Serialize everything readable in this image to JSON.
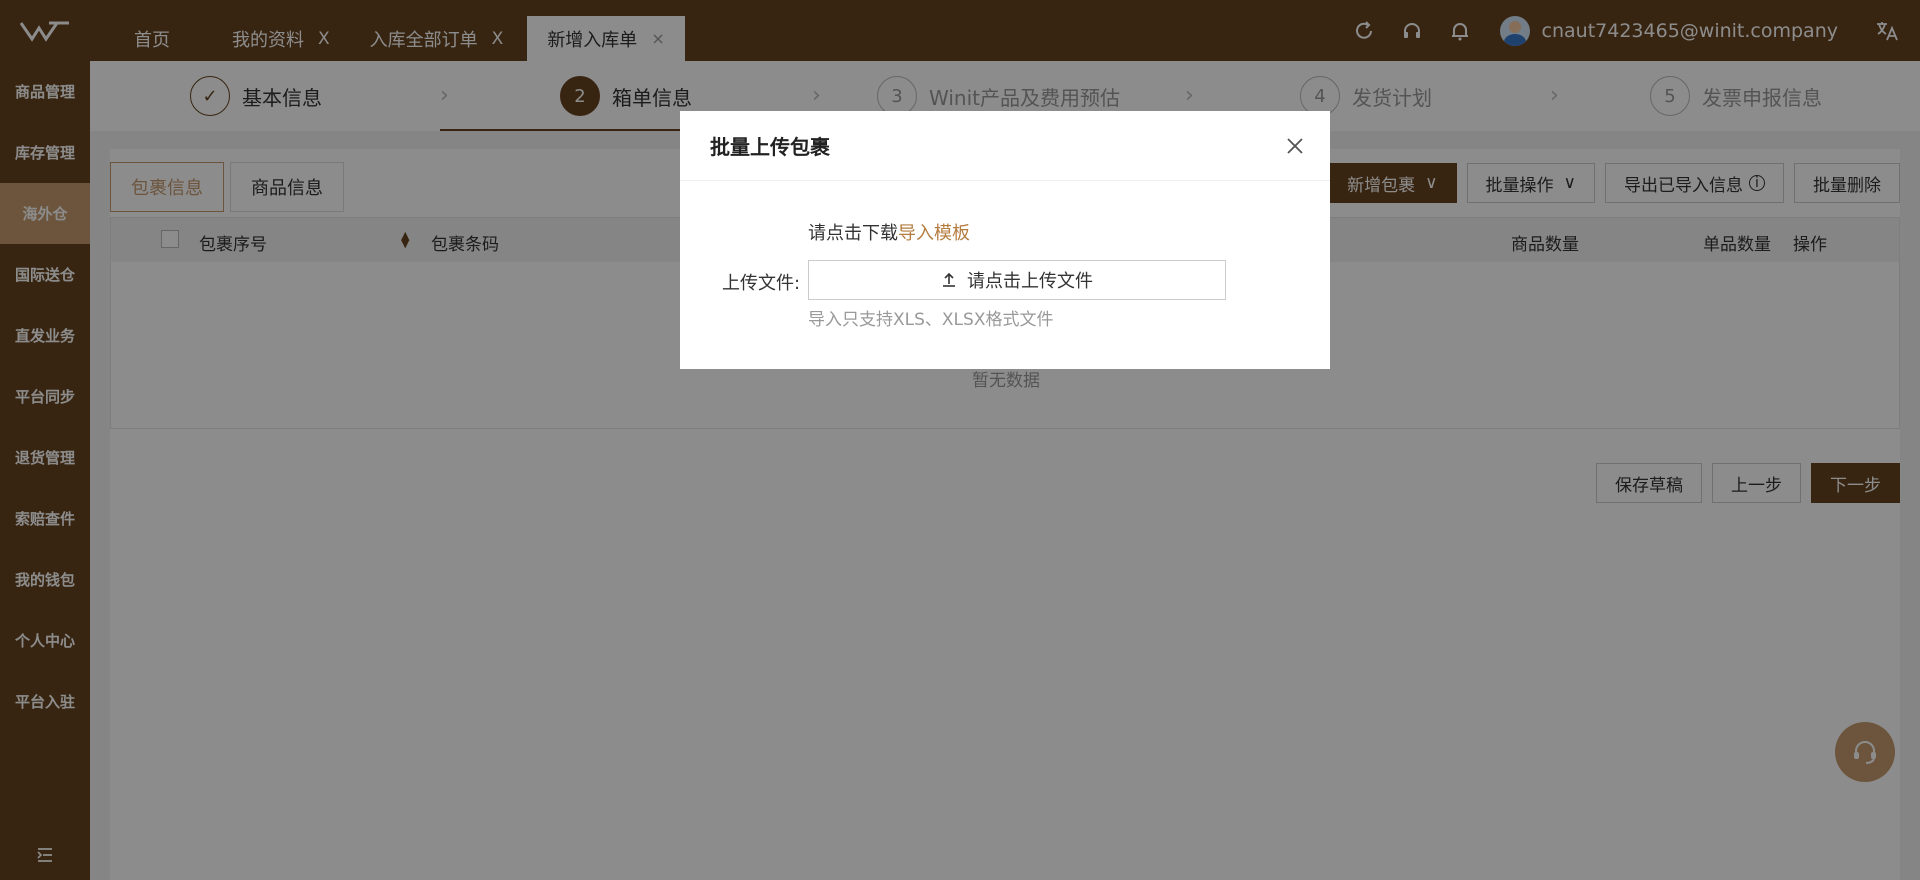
{
  "tabs": {
    "home": "首页",
    "items": [
      {
        "label": "我的资料",
        "close": "X"
      },
      {
        "label": "入库全部订单",
        "close": "X"
      }
    ],
    "active": {
      "label": "新增入库单",
      "close": "×"
    }
  },
  "header": {
    "username": "cnaut7423465@winit.company"
  },
  "sidebar": {
    "items": [
      "商品管理",
      "库存管理",
      "海外仓",
      "国际送仓",
      "直发业务",
      "平台同步",
      "退货管理",
      "索赔查件",
      "我的钱包",
      "个人中心",
      "平台入驻"
    ]
  },
  "steps": [
    {
      "num": "✓",
      "label": "基本信息"
    },
    {
      "num": "2",
      "label": "箱单信息"
    },
    {
      "num": "3",
      "label": "Winit产品及费用预估"
    },
    {
      "num": "4",
      "label": "发货计划"
    },
    {
      "num": "5",
      "label": "发票申报信息"
    }
  ],
  "subtabs": [
    "包裹信息",
    "商品信息"
  ],
  "actions": {
    "add": "新增包裹",
    "batch": "批量操作",
    "export": "导出已导入信息",
    "delete": "批量删除"
  },
  "table": {
    "headers": [
      "包裹序号",
      "包裹条码",
      "商品数量",
      "单品数量",
      "操作"
    ],
    "empty": "暂无数据"
  },
  "footer": {
    "save": "保存草稿",
    "prev": "上一步",
    "next": "下一步"
  },
  "modal": {
    "title": "批量上传包裹",
    "download_prefix": "请点击下载",
    "download_link": "导入模板",
    "upload_label": "上传文件:",
    "upload_button": "请点击上传文件",
    "hint": "导入只支持XLS、XLSX格式文件"
  },
  "colors": {
    "brand": "#66441f",
    "accent": "#c59b6d",
    "link": "#b57c3f"
  }
}
